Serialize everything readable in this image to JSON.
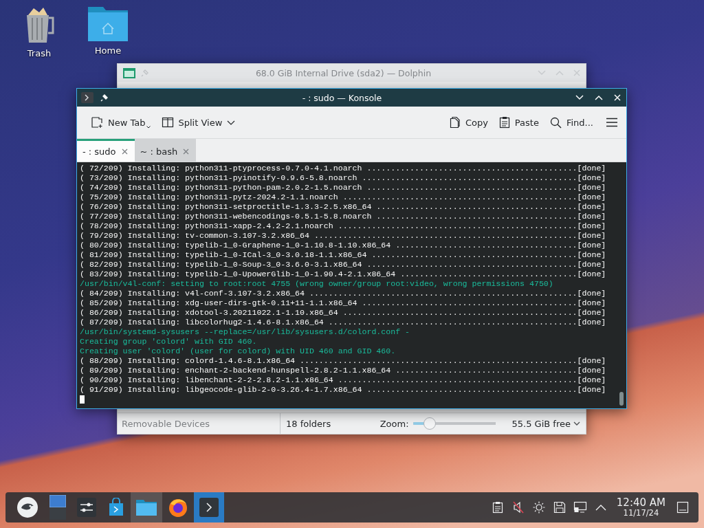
{
  "desktop_icons": [
    {
      "kind": "trash",
      "label": "Trash"
    },
    {
      "kind": "home",
      "label": "Home"
    }
  ],
  "dolphin": {
    "title": "68.0 GiB Internal Drive (sda2) — Dolphin",
    "places_footer": "Removable Devices",
    "status": "18 folders",
    "zoom_label": "Zoom:",
    "zoom": {
      "level": 0.2
    },
    "free_space": "55.5 GiB free"
  },
  "konsole": {
    "title": "- : sudo — Konsole",
    "toolbar": [
      {
        "kind": "new-tab",
        "label": "New Tab"
      },
      {
        "kind": "split",
        "label": "Split View"
      },
      {
        "kind": "copy",
        "label": "Copy"
      },
      {
        "kind": "paste",
        "label": "Paste"
      },
      {
        "kind": "find",
        "label": "Find..."
      }
    ],
    "tabs": [
      {
        "label": "- : sudo",
        "selected": true
      },
      {
        "label": "~ : bash",
        "selected": false
      }
    ],
    "lines": [
      {
        "kind": "output",
        "text": "( 72/209) Installing: python311-ptyprocess-0.7.0-4.1.noarch ............................................[done]"
      },
      {
        "kind": "output",
        "text": "( 73/209) Installing: python311-pyinotify-0.9.6-5.8.noarch .............................................[done]"
      },
      {
        "kind": "output",
        "text": "( 74/209) Installing: python311-python-pam-2.0.2-1.5.noarch ............................................[done]"
      },
      {
        "kind": "output",
        "text": "( 75/209) Installing: python311-pytz-2024.2-1.1.noarch .................................................[done]"
      },
      {
        "kind": "output",
        "text": "( 76/209) Installing: python311-setproctitle-1.3.3-2.5.x86_64 ..........................................[done]"
      },
      {
        "kind": "output",
        "text": "( 77/209) Installing: python311-webencodings-0.5.1-5.8.noarch ..........................................[done]"
      },
      {
        "kind": "output",
        "text": "( 78/209) Installing: python311-xapp-2.4.2-2.1.noarch ..................................................[done]"
      },
      {
        "kind": "output",
        "text": "( 79/209) Installing: tv-common-3.107-3.2.x86_64 .......................................................[done]"
      },
      {
        "kind": "output",
        "text": "( 80/209) Installing: typelib-1_0-Graphene-1_0-1.10.8-1.10.x86_64 ......................................[done]"
      },
      {
        "kind": "output",
        "text": "( 81/209) Installing: typelib-1_0-ICal-3_0-3.0.18-1.1.x86_64 ...........................................[done]"
      },
      {
        "kind": "output",
        "text": "( 82/209) Installing: typelib-1_0-Soup-3_0-3.6.0-3.1.x86_64 ............................................[done]"
      },
      {
        "kind": "output",
        "text": "( 83/209) Installing: typelib-1_0-UpowerGlib-1_0-1.90.4-2.1.x86_64 .....................................[done]"
      },
      {
        "kind": "message",
        "text": "/usr/bin/v4l-conf: setting to root:root 4755 (wrong owner/group root:video, wrong permissions 4750)"
      },
      {
        "kind": "output",
        "text": "( 84/209) Installing: v4l-conf-3.107-3.2.x86_64 ........................................................[done]"
      },
      {
        "kind": "output",
        "text": "( 85/209) Installing: xdg-user-dirs-gtk-0.11+11-1.1.x86_64 .............................................[done]"
      },
      {
        "kind": "output",
        "text": "( 86/209) Installing: xdotool-3.20211022.1-1.10.x86_64 .................................................[done]"
      },
      {
        "kind": "output",
        "text": "( 87/209) Installing: libcolorhug2-1.4.6-8.1.x86_64 ....................................................[done]"
      },
      {
        "kind": "message",
        "text": "/usr/bin/systemd-sysusers --replace=/usr/lib/sysusers.d/colord.conf -"
      },
      {
        "kind": "message",
        "text": "Creating group 'colord' with GID 460."
      },
      {
        "kind": "message",
        "text": "Creating user 'colord' (user for colord) with UID 460 and GID 460."
      },
      {
        "kind": "output",
        "text": "( 88/209) Installing: colord-1.4.6-8.1.x86_64 ..........................................................[done]"
      },
      {
        "kind": "output",
        "text": "( 89/209) Installing: enchant-2-backend-hunspell-2.8.2-1.1.x86_64 ......................................[done]"
      },
      {
        "kind": "output",
        "text": "( 90/209) Installing: libenchant-2-2-2.8.2-1.1.x86_64 ..................................................[done]"
      },
      {
        "kind": "output",
        "text": "( 91/209) Installing: libgeocode-glib-2-0-3.26.4-1.7.x86_64 ............................................[done]"
      }
    ]
  },
  "taskbar": {
    "tasks": [
      {
        "kind": "launcher",
        "active": false
      },
      {
        "kind": "pager",
        "active": false
      },
      {
        "kind": "settings",
        "active": false
      },
      {
        "kind": "store",
        "active": false
      },
      {
        "kind": "files",
        "active": true
      },
      {
        "kind": "browser",
        "active": false
      },
      {
        "kind": "terminal",
        "active": true
      }
    ],
    "tray": [
      {
        "kind": "clipboard"
      },
      {
        "kind": "volume-muted"
      },
      {
        "kind": "brightness"
      },
      {
        "kind": "disk"
      },
      {
        "kind": "network"
      },
      {
        "kind": "expand"
      }
    ],
    "clock": {
      "time": "12:40 AM",
      "date": "11/17/24"
    }
  }
}
